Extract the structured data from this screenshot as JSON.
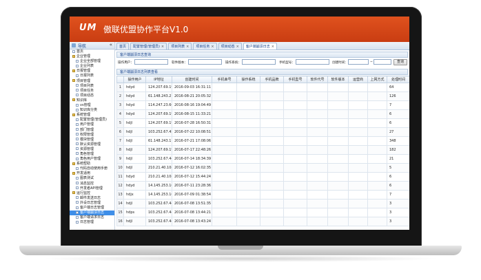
{
  "app": {
    "logo": "UM",
    "title": "傲联优盟协作平台V1.0"
  },
  "sidebar": {
    "header_label": "导航",
    "collapse_glyph": "«",
    "items": [
      {
        "label": "首页",
        "level": 0,
        "type": "doc"
      },
      {
        "label": "企业管理",
        "level": 0,
        "type": "folder"
      },
      {
        "label": "企业全部管理",
        "level": 1,
        "type": "doc"
      },
      {
        "label": "企业列表",
        "level": 1,
        "type": "doc"
      },
      {
        "label": "日报管理",
        "level": 0,
        "type": "folder"
      },
      {
        "label": "日报列表",
        "level": 1,
        "type": "doc"
      },
      {
        "label": "项目管理",
        "level": 0,
        "type": "folder"
      },
      {
        "label": "项目列表",
        "level": 1,
        "type": "doc"
      },
      {
        "label": "项目任务",
        "level": 1,
        "type": "doc"
      },
      {
        "label": "项目动态",
        "level": 1,
        "type": "doc"
      },
      {
        "label": "知识库",
        "level": 0,
        "type": "folder"
      },
      {
        "label": "vs管理",
        "level": 1,
        "type": "doc"
      },
      {
        "label": "知识库分类",
        "level": 1,
        "type": "doc"
      },
      {
        "label": "系统管理",
        "level": 0,
        "type": "folder"
      },
      {
        "label": "配置管理(管理员)",
        "level": 1,
        "type": "doc"
      },
      {
        "label": "用户管理",
        "level": 1,
        "type": "doc"
      },
      {
        "label": "部门管理",
        "level": 1,
        "type": "doc"
      },
      {
        "label": "权限管理",
        "level": 1,
        "type": "doc"
      },
      {
        "label": "模块管理",
        "level": 1,
        "type": "doc"
      },
      {
        "label": "默认资源管理",
        "level": 1,
        "type": "doc"
      },
      {
        "label": "资源管理",
        "level": 1,
        "type": "doc"
      },
      {
        "label": "角色管理",
        "level": 1,
        "type": "doc"
      },
      {
        "label": "角色用户管理",
        "level": 1,
        "type": "doc"
      },
      {
        "label": "系统帮助",
        "level": 0,
        "type": "folder"
      },
      {
        "label": "代码自动使用手册",
        "level": 1,
        "type": "doc"
      },
      {
        "label": "开发适用",
        "level": 0,
        "type": "folder"
      },
      {
        "label": "图表测试",
        "level": 1,
        "type": "doc"
      },
      {
        "label": "消息监控",
        "level": 1,
        "type": "doc"
      },
      {
        "label": "开发者API管理",
        "level": 1,
        "type": "doc"
      },
      {
        "label": "运行监控",
        "level": 0,
        "type": "folder"
      },
      {
        "label": "邮件发送日志",
        "level": 1,
        "type": "doc"
      },
      {
        "label": "外设日志管理",
        "level": 1,
        "type": "doc"
      },
      {
        "label": "客户端日志管理",
        "level": 1,
        "type": "doc"
      },
      {
        "label": "客户端崩溃日志",
        "level": 1,
        "type": "doc",
        "selected": true
      },
      {
        "label": "客户端请求日志",
        "level": 1,
        "type": "doc"
      },
      {
        "label": "日志管理",
        "level": 1,
        "type": "doc"
      }
    ]
  },
  "tabs": [
    {
      "label": "首页",
      "closable": false,
      "active": false
    },
    {
      "label": "配置管理(管理员)",
      "closable": true,
      "active": false
    },
    {
      "label": "项目列表",
      "closable": true,
      "active": false
    },
    {
      "label": "项目任务",
      "closable": true,
      "active": false
    },
    {
      "label": "项目动态",
      "closable": true,
      "active": false
    },
    {
      "label": "客户端崩溃日志",
      "closable": true,
      "active": true
    }
  ],
  "tab_close_glyph": "×",
  "query_panel": {
    "title": "客户端崩溃日志查询",
    "fields": {
      "user_label": "操作用户：",
      "software_version_label": "软件版本：",
      "os_label": "操作系统：",
      "model_label": "手机型号：",
      "created_time_label": "创建时间：",
      "date_separator": "~",
      "user_value": "",
      "software_version_value": "",
      "os_value": "",
      "model_value": "",
      "date_from": "",
      "date_to": ""
    },
    "query_button": "查询"
  },
  "list_panel": {
    "title": "客户端崩溃日志列表查看",
    "columns": [
      "",
      "操作用户",
      "IP地址",
      "创建时间",
      "手机串号",
      "操作系统",
      "手机品牌",
      "手机型号",
      "软件代号",
      "软件版本",
      "运营商",
      "上网方式",
      "处理时间"
    ],
    "rows": [
      [
        "1",
        "hdyd",
        "124.207.69.190",
        "2016-09-03 16:31:11",
        "",
        "",
        "",
        "",
        "",
        "",
        "",
        "",
        "64"
      ],
      [
        "2",
        "hdyd",
        "61.148.243.216",
        "2016-08-21 20:05:32",
        "",
        "",
        "",
        "",
        "",
        "",
        "",
        "",
        "126"
      ],
      [
        "3",
        "hdyd",
        "114.247.23.66",
        "2016-08-16 19:04:49",
        "",
        "",
        "",
        "",
        "",
        "",
        "",
        "",
        "7"
      ],
      [
        "4",
        "hdyd",
        "124.207.69.190",
        "2016-08-15 11:33:21",
        "",
        "",
        "",
        "",
        "",
        "",
        "",
        "",
        "6"
      ],
      [
        "5",
        "hdjl",
        "124.207.69.190",
        "2016-07-28 16:50:31",
        "",
        "",
        "",
        "",
        "",
        "",
        "",
        "",
        "6"
      ],
      [
        "6",
        "hdjl",
        "103.252.67.45",
        "2016-07-22 10:08:51",
        "",
        "",
        "",
        "",
        "",
        "",
        "",
        "",
        "27"
      ],
      [
        "7",
        "hdjl",
        "61.148.243.119",
        "2016-07-21 17:08:06",
        "",
        "",
        "",
        "",
        "",
        "",
        "",
        "",
        "348"
      ],
      [
        "8",
        "hdjl",
        "124.207.69.190",
        "2016-07-17 22:48:26",
        "",
        "",
        "",
        "",
        "",
        "",
        "",
        "",
        "182"
      ],
      [
        "9",
        "hdjl",
        "103.252.67.44",
        "2016-07-14 18:34:39",
        "",
        "",
        "",
        "",
        "",
        "",
        "",
        "",
        "21"
      ],
      [
        "10",
        "hdjl",
        "210.21.40.108",
        "2016-07-12 16:02:35",
        "",
        "",
        "",
        "",
        "",
        "",
        "",
        "",
        "5"
      ],
      [
        "11",
        "hdyd",
        "210.21.40.108",
        "2016-07-12 15:44:24",
        "",
        "",
        "",
        "",
        "",
        "",
        "",
        "",
        "6"
      ],
      [
        "12",
        "hdyd",
        "14.145.253.161",
        "2016-07-11 23:28:36",
        "",
        "",
        "",
        "",
        "",
        "",
        "",
        "",
        "6"
      ],
      [
        "13",
        "hdjx",
        "14.145.253.161",
        "2016-07-09 01:38:54",
        "",
        "",
        "",
        "",
        "",
        "",
        "",
        "",
        "7"
      ],
      [
        "14",
        "hdjl",
        "103.252.67.44",
        "2016-07-08 13:51:35",
        "",
        "",
        "",
        "",
        "",
        "",
        "",
        "",
        "3"
      ],
      [
        "15",
        "hdps",
        "103.252.67.44",
        "2016-07-08 13:44:21",
        "",
        "",
        "",
        "",
        "",
        "",
        "",
        "",
        "3"
      ],
      [
        "16",
        "hdjl",
        "103.252.67.44",
        "2016-07-08 13:43:24",
        "",
        "",
        "",
        "",
        "",
        "",
        "",
        "",
        "3"
      ]
    ]
  },
  "colors": {
    "header_orange": "#d6461a",
    "selected_nav": "#3e8ee8",
    "panel_blue": "#15428b"
  }
}
